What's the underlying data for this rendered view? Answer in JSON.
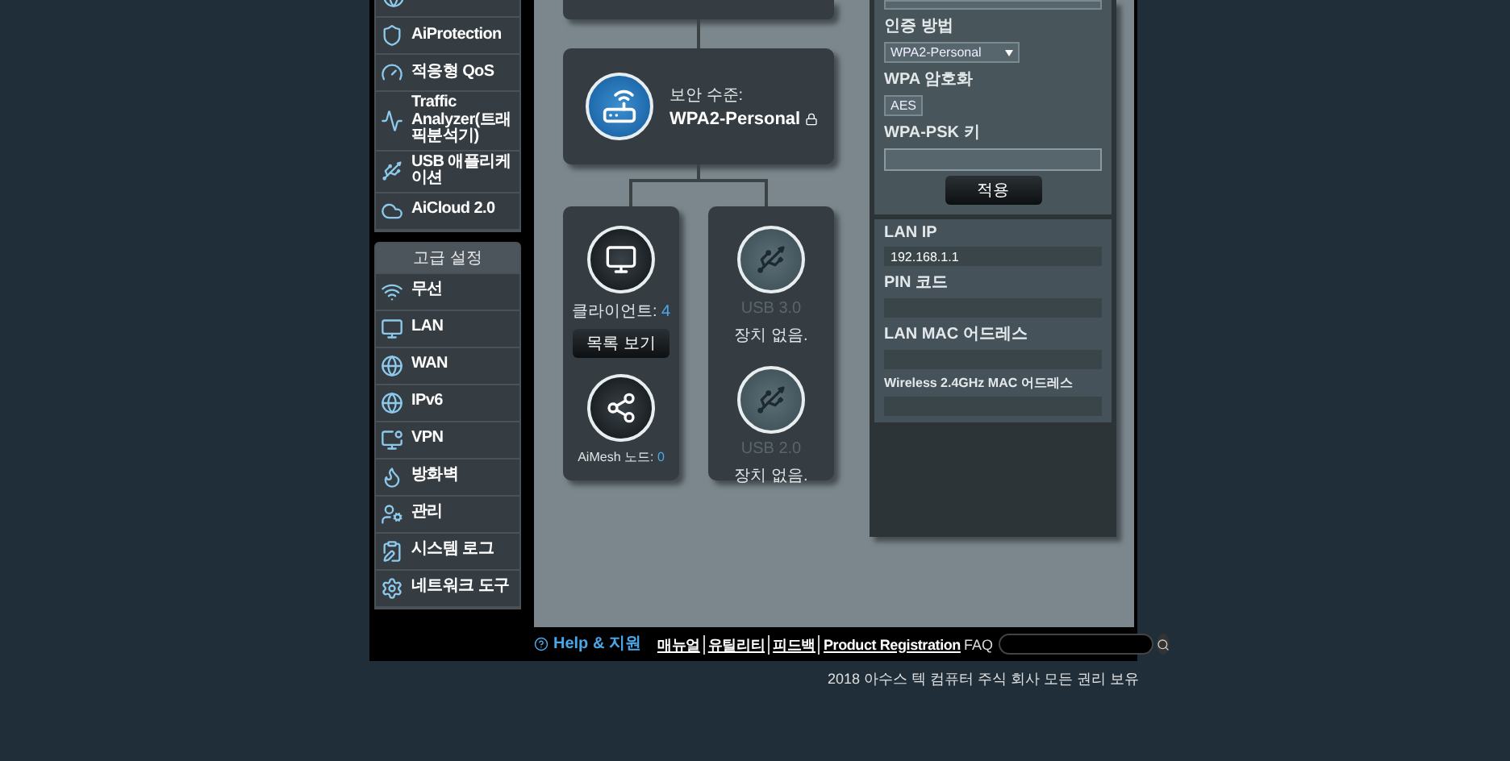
{
  "sidebar": {
    "general_items": [
      {
        "kind": "shield",
        "label": "AiProtection"
      },
      {
        "kind": "gauge",
        "label": "적응형 QoS"
      },
      {
        "kind": "wave",
        "label": "Traffic Analyzer(트래픽분석기)"
      },
      {
        "kind": "usb",
        "label": "USB 애플리케이션"
      },
      {
        "kind": "cloud",
        "label": "AiCloud 2.0"
      }
    ],
    "section_title": "고급 설정",
    "advanced_items": [
      {
        "kind": "wifi",
        "label": "무선"
      },
      {
        "kind": "lan",
        "label": "LAN"
      },
      {
        "kind": "globe",
        "label": "WAN"
      },
      {
        "kind": "globe",
        "label": "IPv6"
      },
      {
        "kind": "vpn",
        "label": "VPN"
      },
      {
        "kind": "fire",
        "label": "방화벽"
      },
      {
        "kind": "admin",
        "label": "관리"
      },
      {
        "kind": "log",
        "label": "시스템 로그"
      },
      {
        "kind": "gear",
        "label": "네트워크 도구"
      }
    ]
  },
  "network_map": {
    "security_label": "보안 수준:",
    "security_value": "WPA2-Personal",
    "clients": {
      "label": "클라이언트:",
      "count": "4",
      "button": "목록 보기"
    },
    "aimesh": {
      "label": "AiMesh 노드:",
      "count": "0"
    },
    "usb_ports": [
      {
        "name": "USB 3.0",
        "status": "장치 없음."
      },
      {
        "name": "USB 2.0",
        "status": "장치 없음."
      }
    ]
  },
  "wireless": {
    "auth_label": "인증 방법",
    "auth_value": "WPA2-Personal",
    "enc_label": "WPA 암호화",
    "enc_value": "AES",
    "psk_label": "WPA-PSK 키",
    "apply": "적용"
  },
  "lan_info": [
    {
      "label": "LAN IP",
      "value": "192.168.1.1"
    },
    {
      "label": "PIN 코드"
    },
    {
      "label": "LAN MAC 어드레스"
    },
    {
      "label": "Wireless 2.4GHz MAC 어드레스"
    }
  ],
  "footer": {
    "help": "Help & 지원",
    "links": [
      "매뉴얼",
      "유틸리티",
      "피드백",
      "Product Registration"
    ],
    "faq": "FAQ",
    "copyright": "2018 아수스 텍 컴퓨터 주식 회사 모든 권리 보유"
  }
}
